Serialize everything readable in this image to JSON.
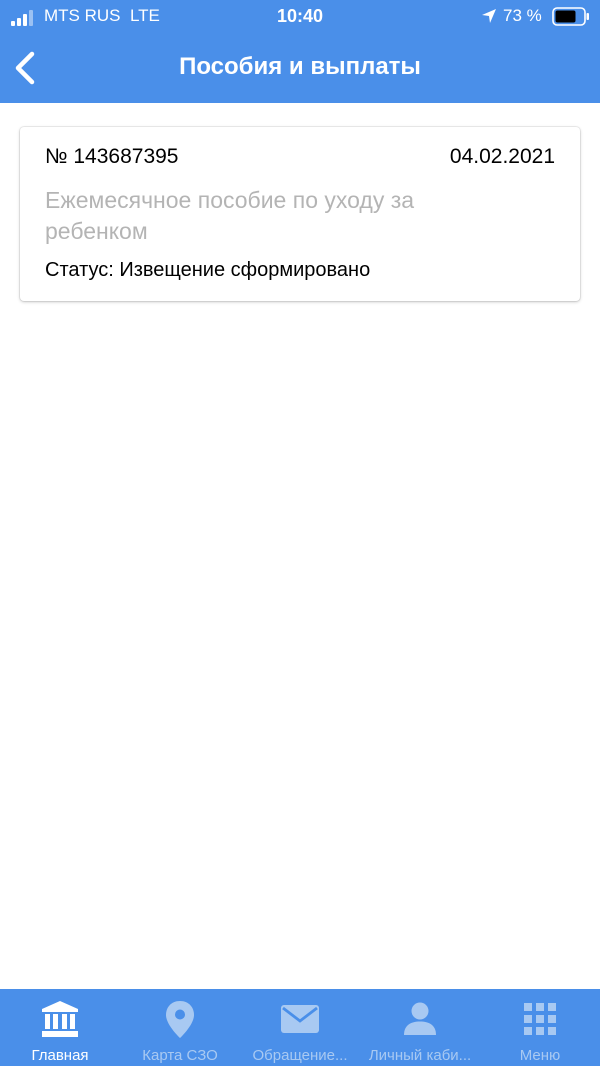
{
  "status_bar": {
    "carrier": "MTS RUS",
    "network": "LTE",
    "time": "10:40",
    "battery": "73 %"
  },
  "header": {
    "title": "Пособия и выплаты",
    "back_icon": "chevron-left-icon"
  },
  "colors": {
    "accent": "#4a8fe9",
    "muted_text": "#b4b4b4",
    "inactive_tab": "#a8c9f2"
  },
  "card": {
    "number": "№ 143687395",
    "date": "04.02.2021",
    "benefit": "Ежемесячное пособие по уходу за ребенком",
    "status": "Статус: Извещение сформировано"
  },
  "tabs": [
    {
      "label": "Главная",
      "icon": "bank-icon",
      "active": true
    },
    {
      "label": "Карта СЗО",
      "icon": "map-pin-icon",
      "active": false
    },
    {
      "label": "Обращение...",
      "icon": "envelope-icon",
      "active": false
    },
    {
      "label": "Личный каби...",
      "icon": "user-icon",
      "active": false
    },
    {
      "label": "Меню",
      "icon": "grid-icon",
      "active": false
    }
  ]
}
